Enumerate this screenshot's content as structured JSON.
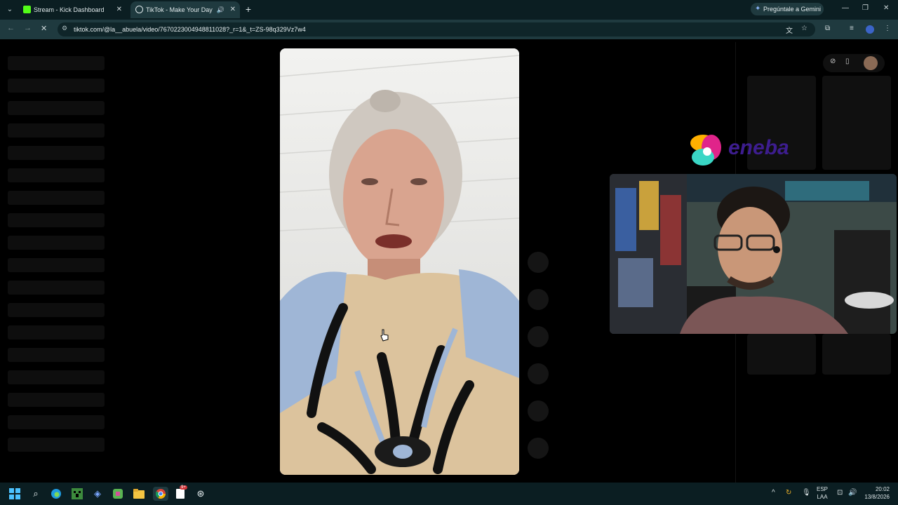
{
  "browser": {
    "tabs": [
      {
        "title": "Stream - Kick Dashboard",
        "favicon_color": "#53fc18"
      },
      {
        "title": "TikTok - Make Your Day",
        "favicon_color": "#dfe8ea"
      }
    ],
    "gemini_label": "Pregúntale a Gemini",
    "url": "tiktok.com/@la__abuela/video/7670223004948811028?_r=1&_t=ZS-98q329Vz7w4"
  },
  "overlay": {
    "brand_text": "eneba",
    "brand_colors": [
      "#ffb000",
      "#e0248a",
      "#3ad6c5",
      "#3d1d8f"
    ]
  },
  "taskbar": {
    "language_top": "ESP",
    "language_bottom": "LAA",
    "time": "20:02",
    "date": "13/8/2026",
    "notification_badge": "9+"
  },
  "icons": {
    "tab_menu": "chevron-down-icon",
    "back": "back-arrow-icon",
    "forward": "forward-arrow-icon",
    "reload": "stop-loading-icon",
    "site_settings": "tune-icon",
    "translate": "translate-icon",
    "bookmark": "star-icon",
    "extensions": "puzzle-icon",
    "media": "media-controls-icon",
    "profile": "profile-avatar-icon",
    "menu": "kebab-menu-icon"
  }
}
